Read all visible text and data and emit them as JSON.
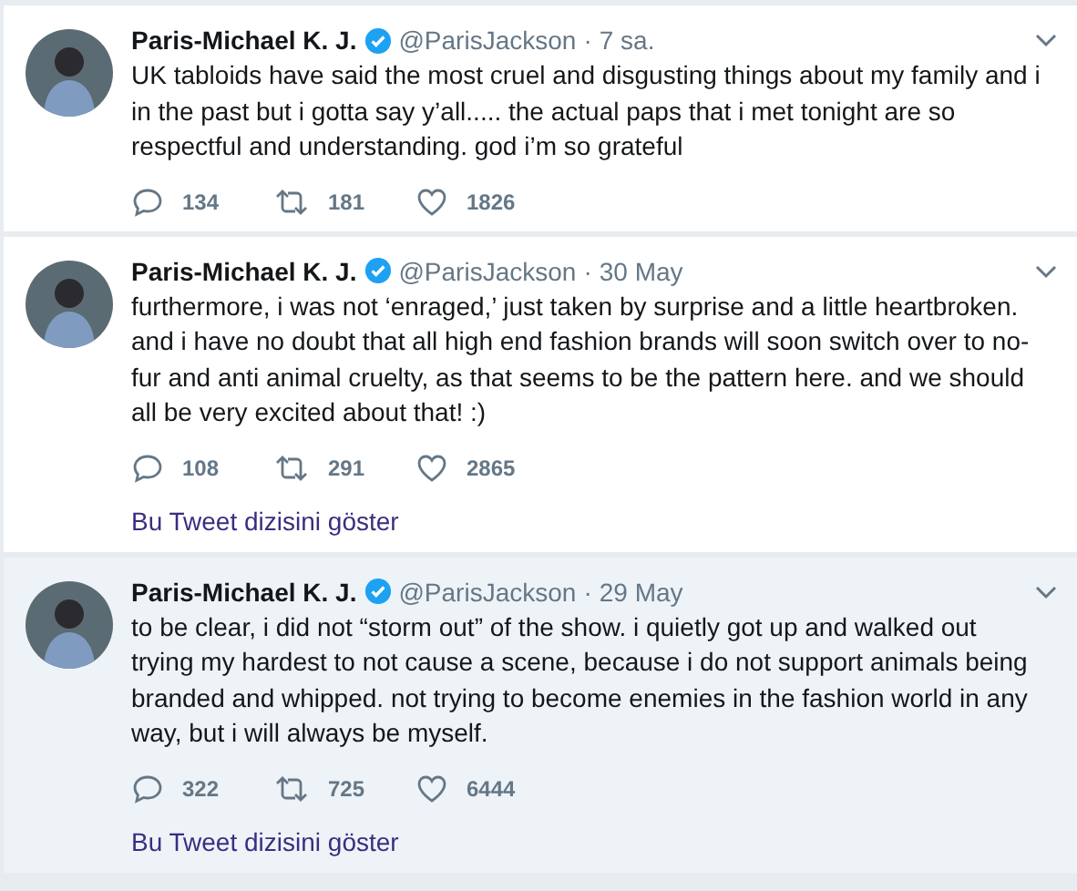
{
  "tweets": [
    {
      "name": "Paris-Michael K. J.",
      "verified": true,
      "handle": "@ParisJackson",
      "separator": "·",
      "time": "7 sa.",
      "highlighted": false,
      "text": "UK tabloids have said the most cruel and disgusting things about my family and i in the past but i gotta say y’all..... the actual paps that i met tonight are so respectful and understanding. god i’m so grateful",
      "replies": "134",
      "retweets": "181",
      "likes": "1826"
    },
    {
      "name": "Paris-Michael K. J.",
      "verified": true,
      "handle": "@ParisJackson",
      "separator": "·",
      "time": "30 May",
      "highlighted": false,
      "text": "furthermore, i was not ‘enraged,’ just taken by surprise and a little heartbroken. and i have no doubt that all high end fashion brands will soon switch over to no-fur and anti animal cruelty, as that seems to be the pattern here. and we should all be very excited about that! :)",
      "replies": "108",
      "retweets": "291",
      "likes": "2865",
      "thread_link": "Bu Tweet dizisini göster"
    },
    {
      "name": "Paris-Michael K. J.",
      "verified": true,
      "handle": "@ParisJackson",
      "separator": "·",
      "time": "29 May",
      "highlighted": true,
      "text": "to be clear, i did not “storm out” of the show. i quietly got up and walked out trying my hardest to not cause a scene, because i do not support animals being branded and whipped. not trying to become enemies in the fashion world in any way, but i will always be myself.",
      "replies": "322",
      "retweets": "725",
      "likes": "6444",
      "thread_link": "Bu Tweet dizisini göster"
    }
  ]
}
